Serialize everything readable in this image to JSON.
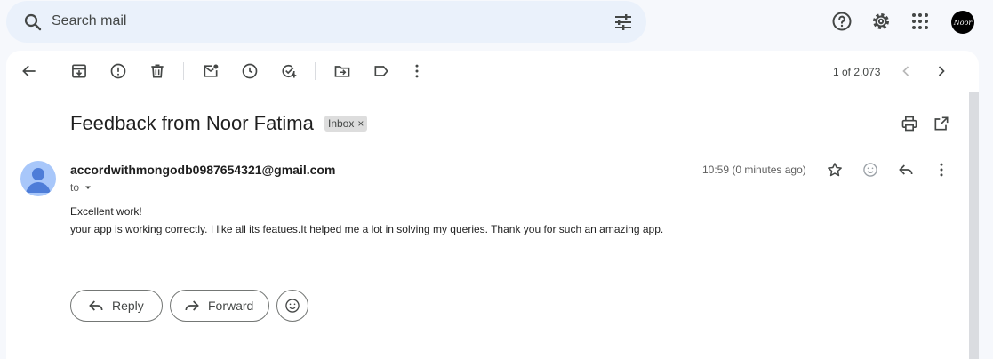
{
  "search": {
    "placeholder": "Search mail"
  },
  "account": {
    "avatar_text": "Noor"
  },
  "pager": {
    "text": "1 of 2,073"
  },
  "email": {
    "subject": "Feedback from Noor Fatima",
    "label": "Inbox",
    "label_remove": "×",
    "sender": "accordwithmongodb0987654321@gmail.com",
    "to": "to",
    "time": "10:59 (0 minutes ago)",
    "body_line1": "Excellent work!",
    "body_line2": "your app is working correctly. I like all its featues.It helped me a lot in solving my queries. Thank you for such an amazing app."
  },
  "actions": {
    "reply": "Reply",
    "forward": "Forward"
  },
  "colors": {
    "background": "#f6f8fc",
    "search_bg": "#eaf1fb",
    "avatar": "#a8c7fa",
    "icon": "#444746"
  }
}
